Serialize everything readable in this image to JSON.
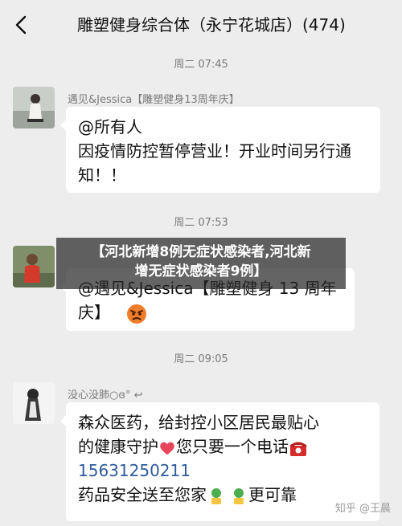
{
  "header": {
    "title": "雕塑健身综合体（永宁花城店）(474)"
  },
  "messages": [
    {
      "time": "周二 07:45",
      "sender": "遇见&Jessica【雕塑健身13周年庆】",
      "lines": [
        "@所有人",
        "因疫情防控暂停营业！开业时间另行通",
        "知！！"
      ]
    },
    {
      "time": "周二 07:53",
      "sender": "",
      "lines": [
        "@遇见&Jessica【雕塑健身 13 周年",
        "庆】"
      ]
    },
    {
      "time": "周二 09:05",
      "sender": "没心没肺○ɞ° ↩",
      "lines": [
        "森众医药，给封控小区居民最贴心",
        "的健康守护",
        "您只要一个电话",
        "15631250211",
        "药品安全送至您家",
        "更可靠"
      ]
    }
  ],
  "overlay": {
    "line1": "【河北新增8例无症状感染者,河北新",
    "line2": "增无症状感染者9例】"
  },
  "watermark": "知乎 @王晨",
  "icons": [
    "back-arrow-icon",
    "angry-face-emoji",
    "heart-emoji",
    "telephone-emoji",
    "thumbs-up-emoji"
  ]
}
